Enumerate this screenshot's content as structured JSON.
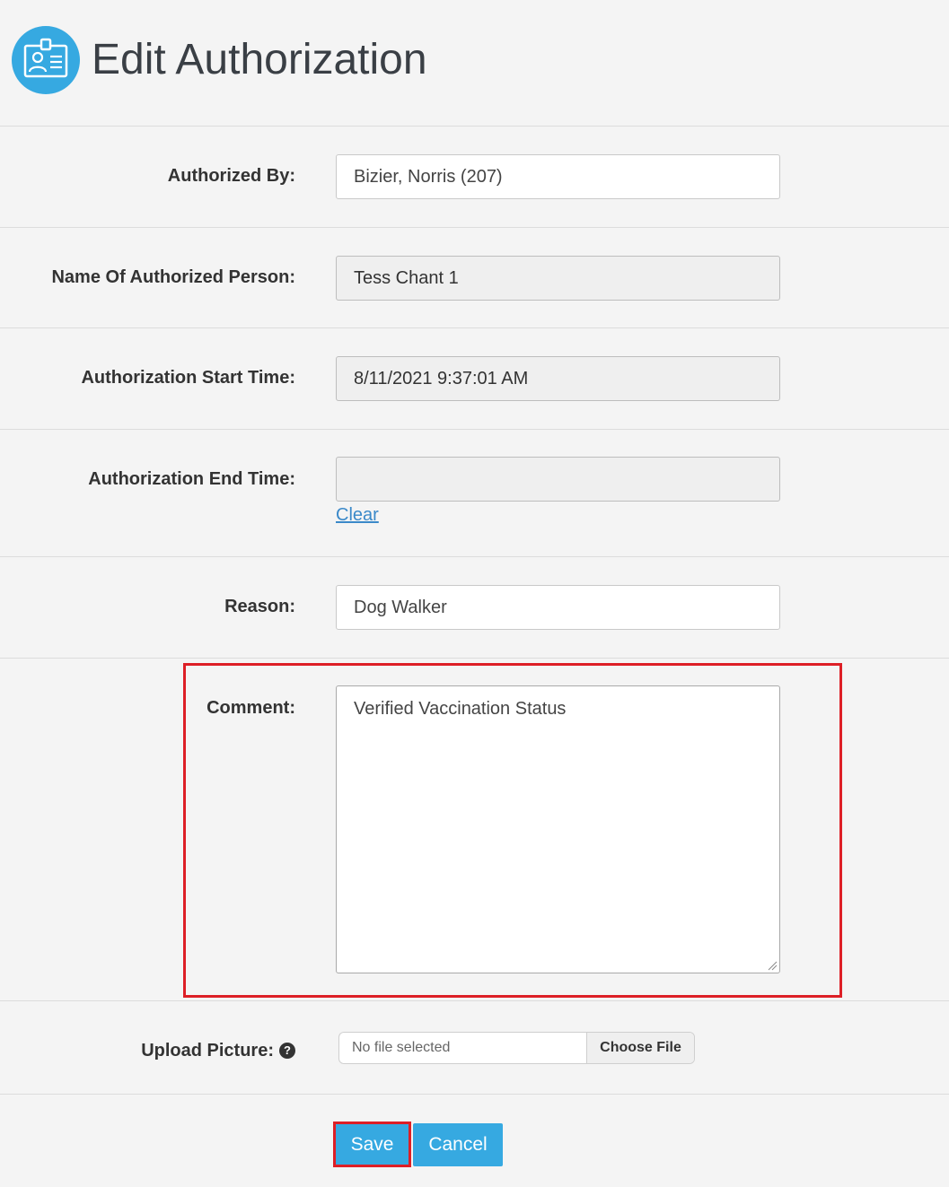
{
  "header": {
    "title": "Edit Authorization",
    "icon": "id-badge-icon",
    "icon_color": "#36a9e1"
  },
  "form": {
    "authorized_by": {
      "label": "Authorized By:",
      "value": "Bizier, Norris  (207)"
    },
    "authorized_person": {
      "label": "Name Of Authorized Person:",
      "value": "Tess Chant 1"
    },
    "start_time": {
      "label": "Authorization Start Time:",
      "value": "8/11/2021 9:37:01 AM"
    },
    "end_time": {
      "label": "Authorization End Time:",
      "value": "",
      "clear_label": "Clear"
    },
    "reason": {
      "label": "Reason:",
      "value": "Dog Walker"
    },
    "comment": {
      "label": "Comment:",
      "value": "Verified Vaccination Status"
    },
    "upload": {
      "label": "Upload Picture:",
      "help_icon": "question-circle-icon",
      "status": "No file selected",
      "button_label": "Choose File"
    }
  },
  "actions": {
    "save_label": "Save",
    "cancel_label": "Cancel",
    "button_color": "#36a9e1",
    "highlight_color": "#dd1f26"
  }
}
